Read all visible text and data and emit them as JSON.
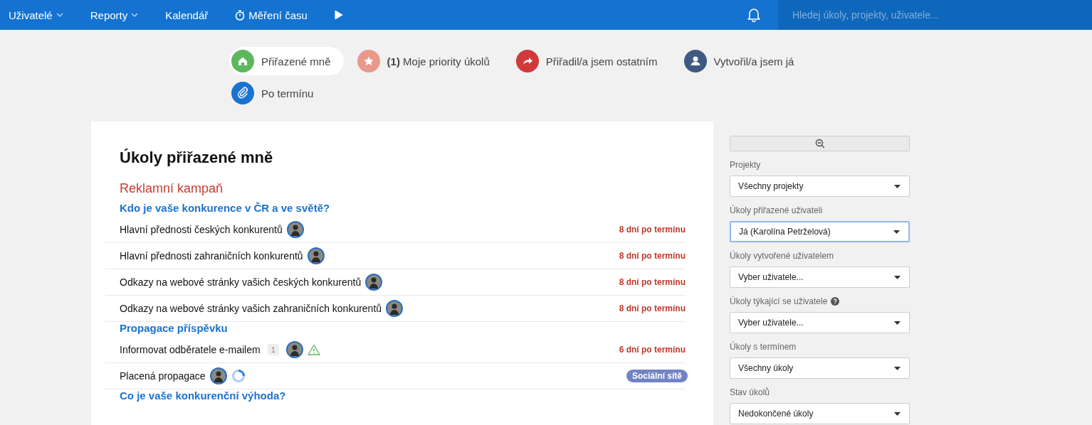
{
  "nav": {
    "items": [
      {
        "label": "Uživatelé",
        "kind": "dropdown"
      },
      {
        "label": "Reporty",
        "kind": "dropdown"
      },
      {
        "label": "Kalendář",
        "kind": "plain"
      },
      {
        "label": "Měření času",
        "kind": "timer"
      },
      {
        "kind": "play"
      }
    ],
    "search": {
      "placeholder": "Hledej úkoly, projekty, uživatele..."
    }
  },
  "tabs": [
    {
      "label": "Přiřazené mně",
      "color": "#5cb85c",
      "selected": true
    },
    {
      "label": "**(1)** Moje priority úkolů",
      "color": "#e9998c",
      "selected": false
    },
    {
      "label": "Přiřadil/a jsem ostatním",
      "color": "#d2393b",
      "selected": false
    },
    {
      "label": "Vytvořil/a jsem já",
      "color": "#3e5a82",
      "selected": false
    },
    {
      "label": "Po termínu",
      "color": "#1a73d0",
      "selected": false
    }
  ],
  "main": {
    "title": "Úkoly přiřazené mně",
    "project": "Reklamní kampaň",
    "groups": [
      {
        "heading": "Kdo je vaše konkurence v ČR a ve světě?",
        "tasks": [
          {
            "name": "Hlavní přednosti českých konkurentů",
            "due": "8 dní po termínu"
          },
          {
            "name": "Hlavní přednosti zahraničních konkurentů",
            "due": "8 dní po termínu"
          },
          {
            "name": "Odkazy na webové stránky vašich českých konkurentů",
            "due": "8 dní po termínu"
          },
          {
            "name": "Odkazy na webové stránky vašich zahraničních konkurentů",
            "due": "8 dní po termínu"
          }
        ]
      },
      {
        "heading": "Propagace příspěvku",
        "tasks": [
          {
            "name": "Informovat odběratele e-mailem",
            "count": "1",
            "warning": true,
            "due": "6 dní po termínu"
          },
          {
            "name": "Placená propagace",
            "progress": true,
            "tag": "Sociální sítě"
          }
        ]
      },
      {
        "heading": "Co je vaše konkurenční výhoda?"
      }
    ]
  },
  "sidebar": {
    "filters": [
      {
        "label": "Projekty",
        "value": "Všechny projekty",
        "focused": false
      },
      {
        "label": "Úkoly přiřazené uživateli",
        "value": "Já (Karolína Petrželová)",
        "focused": true
      },
      {
        "label": "Úkoly vytvořené uživatelem",
        "value": "Vyber uživatele...",
        "focused": false
      },
      {
        "label": "Úkoly týkající se uživatele",
        "value": "Vyber uživatele...",
        "focused": false,
        "help": true
      },
      {
        "label": "Úkoly s termínem",
        "value": "Všechny úkoly",
        "focused": false
      },
      {
        "label": "Stav úkolů",
        "value": "Nedokončené úkoly",
        "focused": false
      }
    ]
  }
}
